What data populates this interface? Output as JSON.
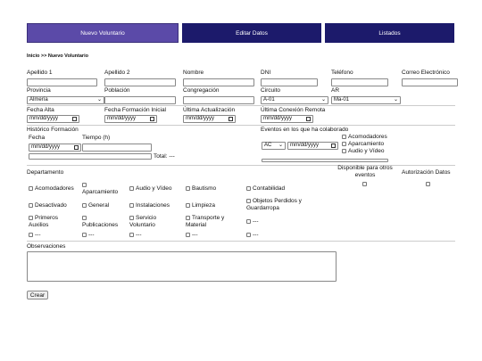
{
  "tabs": [
    {
      "label": "Nuevo Voluntario"
    },
    {
      "label": "Editar Datos"
    },
    {
      "label": "Listados"
    }
  ],
  "breadcrumb": "Inicio >> Nuevo Voluntario",
  "row1": {
    "apellido1": "Apellido 1",
    "apellido2": "Apellido 2",
    "nombre": "Nombre",
    "dni": "DNI",
    "telefono": "Teléfono",
    "email": "Correo Electrónico"
  },
  "row2": {
    "provincia": "Provincia",
    "provincia_value": "Almería",
    "poblacion": "Población",
    "congregacion": "Congregación",
    "circuito": "Circuito",
    "circuito_value": "A-01",
    "ar": "AR",
    "ar_value": "Ma-01"
  },
  "row3": {
    "fecha_alta": "Fecha Alta",
    "fecha_formacion": "Fecha Formación Inicial",
    "ultima_actualizacion": "Última Actualización",
    "ultima_conexion": "Última Conexión Remota",
    "date_placeholder": "mm/dd/yyyy"
  },
  "historico": {
    "title": "Histórico Formación",
    "fecha": "Fecha",
    "tiempo": "Tiempo (h)",
    "date_placeholder": "mm/dd/yyyy",
    "total": "Total: ---"
  },
  "eventos": {
    "title": "Eventos en los que ha colaborado",
    "select_value": "AC",
    "date_placeholder": "mm/dd/yyyy",
    "items": [
      "Acomodadores",
      "Aparcamiento",
      "Audio y Vídeo"
    ]
  },
  "departamento": {
    "title": "Departamento",
    "disponible": "Disponible para otros eventos",
    "autorizacion": "Autorización Datos",
    "items": [
      "Acomodadores",
      "Aparcamiento",
      "Audio y Vídeo",
      "Bautismo",
      "Contabilidad",
      "Desactivado",
      "General",
      "Instalaciones",
      "Limpieza",
      "Objetos Perdidos y Guardarropa",
      "Primeros Auxilios",
      "Publicaciones",
      "Servicio Voluntario",
      "Transporte y Material",
      "---",
      "---",
      "---",
      "---",
      "---",
      "---"
    ]
  },
  "observaciones": "Observaciones",
  "crear": "Crear"
}
